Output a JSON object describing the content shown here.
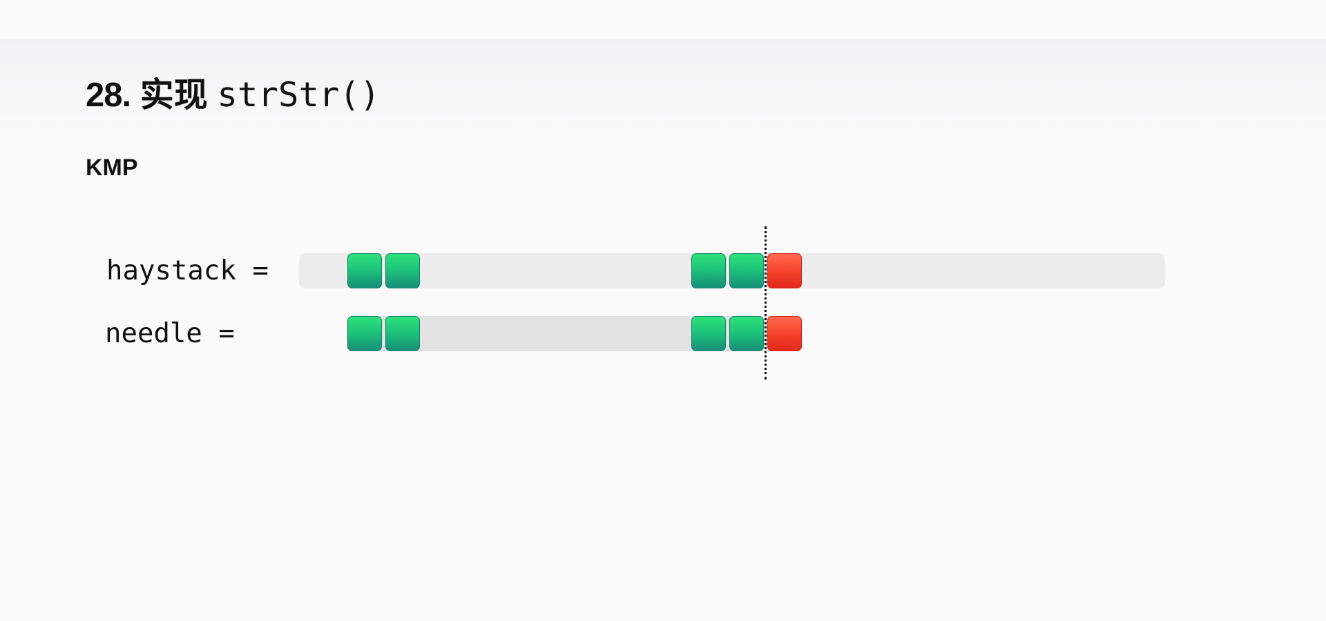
{
  "title": {
    "number": "28.",
    "cjk": "实现",
    "code": "strStr()"
  },
  "subtitle": "KMP",
  "rows": {
    "haystack_label": "haystack =",
    "needle_label": "needle ="
  },
  "colors": {
    "match": "#1ec57a",
    "mismatch": "#f4442c",
    "track": "#ececec"
  }
}
